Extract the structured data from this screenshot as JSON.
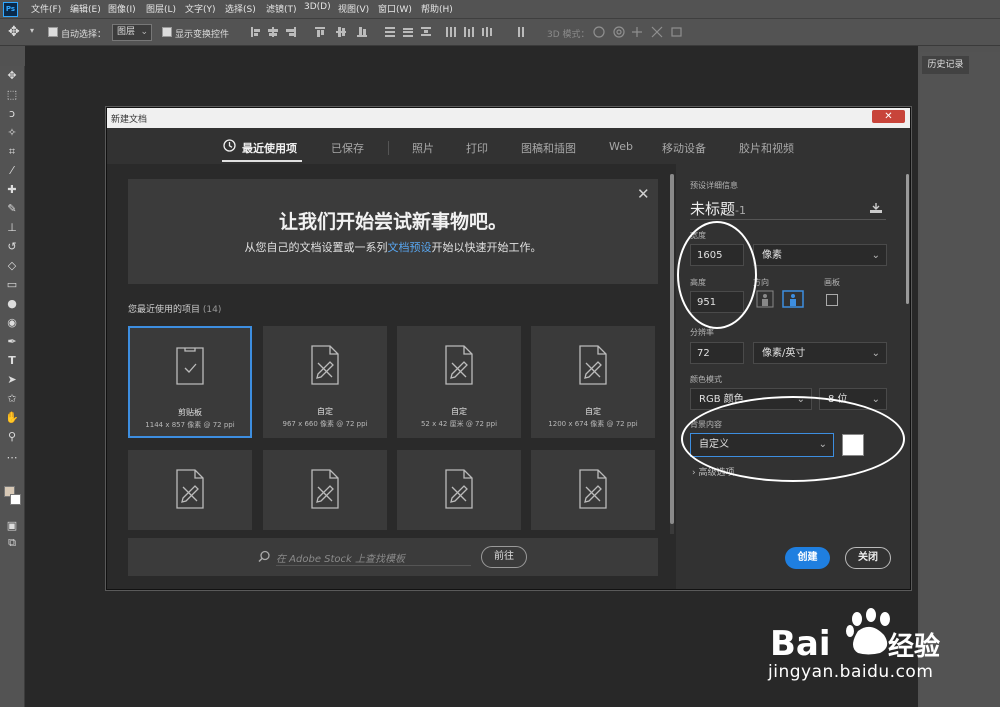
{
  "app": {
    "logo": "Ps"
  },
  "menu": [
    "文件(F)",
    "编辑(E)",
    "图像(I)",
    "图层(L)",
    "文字(Y)",
    "选择(S)",
    "滤镜(T)",
    "3D(D)",
    "视图(V)",
    "窗口(W)",
    "帮助(H)"
  ],
  "options": {
    "auto_select_label": "自动选择：",
    "layer_select_value": "图层",
    "show_transform_label": "显示变换控件",
    "mode_3d_label": "3D 模式："
  },
  "history_tab": "历史记录",
  "dialog": {
    "title": "新建文档",
    "close_glyph": "✕",
    "tabs": [
      "最近使用项",
      "已保存",
      "照片",
      "打印",
      "图稿和插图",
      "Web",
      "移动设备",
      "胶片和视频"
    ],
    "banner": {
      "title": "让我们开始尝试新事物吧。",
      "sub_before": "从您自己的文档设置或一系列",
      "sub_link": "文档预设",
      "sub_after": "开始以快速开始工作。",
      "close_glyph": "✕"
    },
    "recent": {
      "label": "您最近使用的项目",
      "count": "(14)",
      "items": [
        {
          "name": "剪贴板",
          "dims": "1144 x 857 像素 @ 72 ppi"
        },
        {
          "name": "自定",
          "dims": "967 x 660 像素 @ 72 ppi"
        },
        {
          "name": "自定",
          "dims": "52 x 42 厘米 @ 72 ppi"
        },
        {
          "name": "自定",
          "dims": "1200 x 674 像素 @ 72 ppi"
        }
      ]
    },
    "stock": {
      "placeholder": "在 Adobe Stock 上查找模板",
      "go": "前往"
    },
    "preset": {
      "header": "预设详细信息",
      "title": "未标题",
      "title_suffix": "-1",
      "width_label": "宽度",
      "width_value": "1605",
      "width_unit": "像素",
      "height_label": "高度",
      "height_value": "951",
      "orientation_label": "方向",
      "artboard_label": "画板",
      "resolution_label": "分辨率",
      "resolution_value": "72",
      "resolution_unit": "像素/英寸",
      "color_mode_label": "颜色模式",
      "color_mode_value": "RGB 颜色",
      "bit_depth": "8 位",
      "background_label": "背景内容",
      "background_value": "自定义",
      "advanced_label": "高级选项"
    },
    "buttons": {
      "create": "创建",
      "close": "关闭"
    }
  },
  "watermark": {
    "logo_text": "Bai",
    "logo_suffix": "经验",
    "url": "jingyan.baidu.com"
  }
}
